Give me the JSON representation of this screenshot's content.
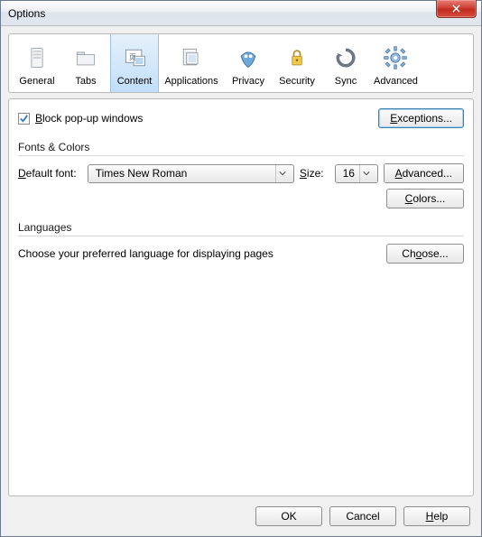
{
  "window": {
    "title": "Options"
  },
  "toolbar": {
    "items": [
      {
        "label": "General"
      },
      {
        "label": "Tabs"
      },
      {
        "label": "Content"
      },
      {
        "label": "Applications"
      },
      {
        "label": "Privacy"
      },
      {
        "label": "Security"
      },
      {
        "label": "Sync"
      },
      {
        "label": "Advanced"
      }
    ],
    "active_index": 2
  },
  "popups": {
    "block_label": "Block pop-up windows",
    "block_checked": true,
    "exceptions_label": "Exceptions..."
  },
  "fonts": {
    "group_label": "Fonts & Colors",
    "default_font_label": "Default font:",
    "default_font_value": "Times New Roman",
    "size_label": "Size:",
    "size_value": "16",
    "advanced_label": "Advanced...",
    "colors_label": "Colors..."
  },
  "languages": {
    "group_label": "Languages",
    "description": "Choose your preferred language for displaying pages",
    "choose_label": "Choose..."
  },
  "footer": {
    "ok_label": "OK",
    "cancel_label": "Cancel",
    "help_label": "Help"
  }
}
